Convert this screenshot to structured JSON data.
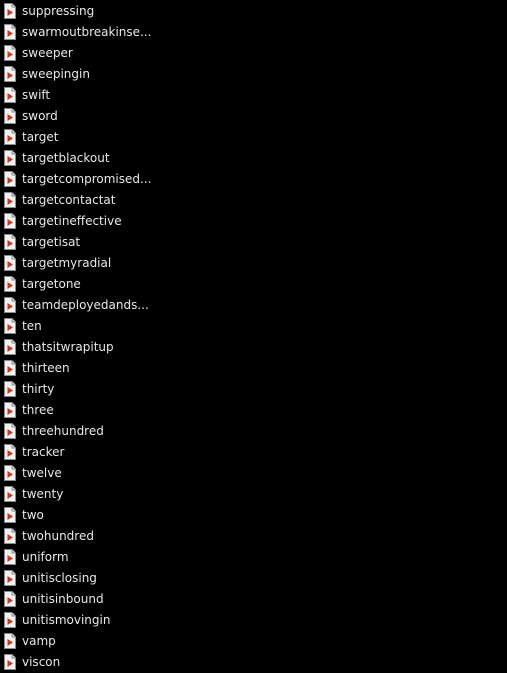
{
  "files": [
    {
      "name": "suppressing",
      "icon": "audio-file-icon"
    },
    {
      "name": "swarmoutbreakinse...",
      "icon": "audio-file-icon"
    },
    {
      "name": "sweeper",
      "icon": "audio-file-icon"
    },
    {
      "name": "sweepingin",
      "icon": "audio-file-icon"
    },
    {
      "name": "swift",
      "icon": "audio-file-icon"
    },
    {
      "name": "sword",
      "icon": "audio-file-icon"
    },
    {
      "name": "target",
      "icon": "audio-file-icon"
    },
    {
      "name": "targetblackout",
      "icon": "audio-file-icon"
    },
    {
      "name": "targetcompromised...",
      "icon": "audio-file-icon"
    },
    {
      "name": "targetcontactat",
      "icon": "audio-file-icon"
    },
    {
      "name": "targetineffective",
      "icon": "audio-file-icon"
    },
    {
      "name": "targetisat",
      "icon": "audio-file-icon"
    },
    {
      "name": "targetmyradial",
      "icon": "audio-file-icon"
    },
    {
      "name": "targetone",
      "icon": "audio-file-icon"
    },
    {
      "name": "teamdeployedands...",
      "icon": "audio-file-icon"
    },
    {
      "name": "ten",
      "icon": "audio-file-icon"
    },
    {
      "name": "thatsitwrapitup",
      "icon": "audio-file-icon"
    },
    {
      "name": "thirteen",
      "icon": "audio-file-icon"
    },
    {
      "name": "thirty",
      "icon": "audio-file-icon"
    },
    {
      "name": "three",
      "icon": "audio-file-icon"
    },
    {
      "name": "threehundred",
      "icon": "audio-file-icon"
    },
    {
      "name": "tracker",
      "icon": "audio-file-icon"
    },
    {
      "name": "twelve",
      "icon": "audio-file-icon"
    },
    {
      "name": "twenty",
      "icon": "audio-file-icon"
    },
    {
      "name": "two",
      "icon": "audio-file-icon"
    },
    {
      "name": "twohundred",
      "icon": "audio-file-icon"
    },
    {
      "name": "uniform",
      "icon": "audio-file-icon"
    },
    {
      "name": "unitisclosing",
      "icon": "audio-file-icon"
    },
    {
      "name": "unitisinbound",
      "icon": "audio-file-icon"
    },
    {
      "name": "unitismovingin",
      "icon": "audio-file-icon"
    },
    {
      "name": "vamp",
      "icon": "audio-file-icon"
    },
    {
      "name": "viscon",
      "icon": "audio-file-icon"
    }
  ],
  "colors": {
    "background": "#000000",
    "text": "#e8e8e8",
    "icon_page": "#f2f2f2",
    "icon_play": "#c83a1e"
  }
}
